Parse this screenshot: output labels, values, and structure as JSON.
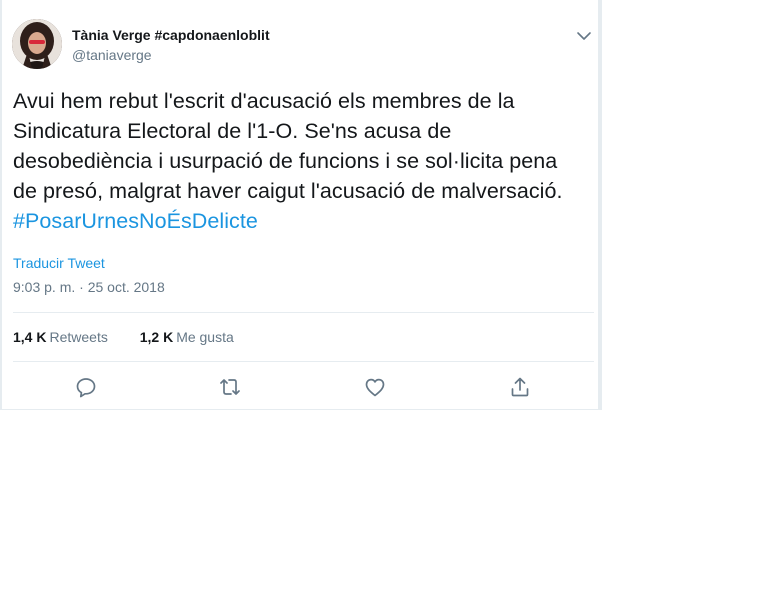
{
  "user": {
    "display_name": "Tània Verge #capdonaenloblit",
    "handle": "@taniaverge"
  },
  "tweet": {
    "text_line1": "Avui hem rebut l'escrit d'acusació els membres de la",
    "text_line2": "Sindicatura Electoral de l'1-O. Se'ns acusa de",
    "text_line3": "desobediència i usurpació de funcions i se sol·licita pena",
    "text_line4": "de presó, malgrat haver caigut l'acusació de malversació.",
    "hashtag": "#PosarUrnesNoÉsDelicte",
    "translate_label": "Traducir Tweet",
    "timestamp": "9:03 p. m. · 25 oct. 2018"
  },
  "stats": {
    "retweets_count": "1,4 K",
    "retweets_label": "Retweets",
    "likes_count": "1,2 K",
    "likes_label": "Me gusta"
  },
  "icons": {
    "caret": "chevron-down-icon",
    "reply": "reply-icon",
    "retweet": "retweet-icon",
    "like": "heart-icon",
    "share": "share-icon"
  },
  "colors": {
    "text": "#14171a",
    "secondary": "#657786",
    "link": "#1b95e0",
    "border": "#e6ecf0"
  }
}
